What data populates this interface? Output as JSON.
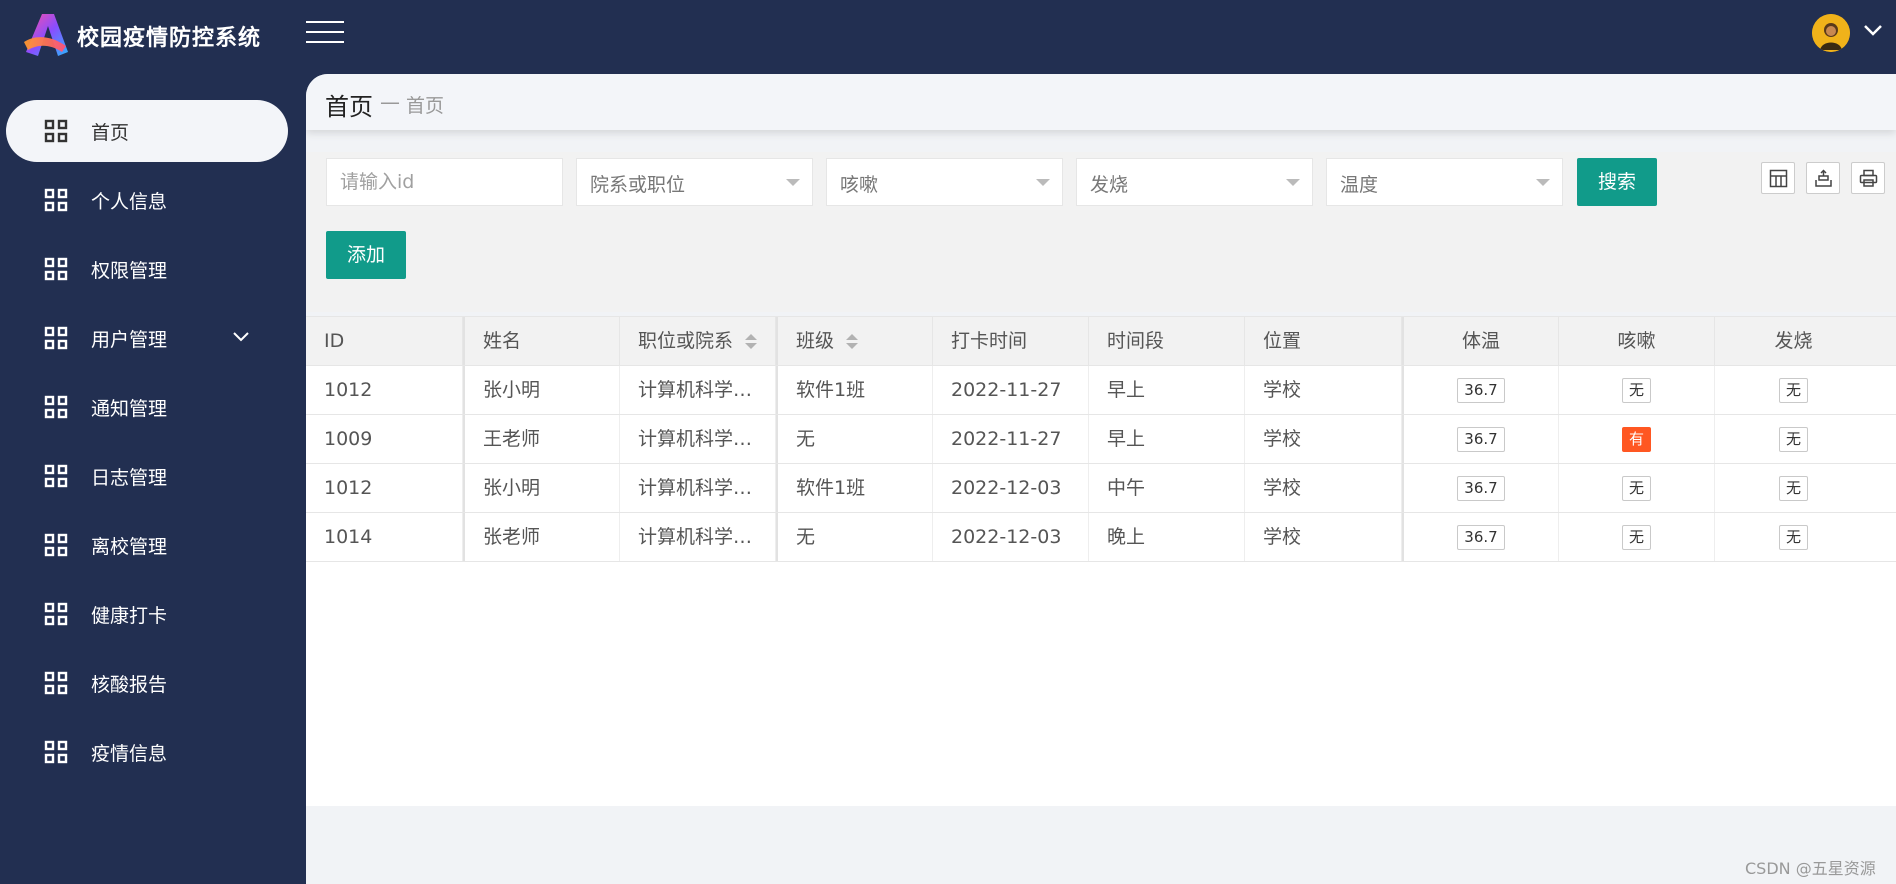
{
  "app": {
    "title": "校园疫情防控系统"
  },
  "breadcrumb": {
    "main": "首页",
    "separator": "—",
    "sub": "首页"
  },
  "sidebar": {
    "items": [
      {
        "label": "首页",
        "active": true
      },
      {
        "label": "个人信息"
      },
      {
        "label": "权限管理"
      },
      {
        "label": "用户管理",
        "has_submenu": true
      },
      {
        "label": "通知管理"
      },
      {
        "label": "日志管理"
      },
      {
        "label": "离校管理"
      },
      {
        "label": "健康打卡"
      },
      {
        "label": "核酸报告"
      },
      {
        "label": "疫情信息"
      }
    ]
  },
  "filters": {
    "id_placeholder": "请输入id",
    "dept_select": "院系或职位",
    "cough_select": "咳嗽",
    "fever_select": "发烧",
    "temp_select": "温度",
    "search_label": "搜索",
    "add_label": "添加"
  },
  "table": {
    "columns": [
      "ID",
      "姓名",
      "职位或院系",
      "班级",
      "打卡时间",
      "时间段",
      "位置",
      "体温",
      "咳嗽",
      "发烧"
    ],
    "rows": [
      {
        "id": "1012",
        "name": "张小明",
        "dept": "计算机科学…",
        "class": "软件1班",
        "time": "2022-11-27",
        "period": "早上",
        "location": "学校",
        "temp": "36.7",
        "cough": "无",
        "fever": "无"
      },
      {
        "id": "1009",
        "name": "王老师",
        "dept": "计算机科学…",
        "class": "无",
        "time": "2022-11-27",
        "period": "早上",
        "location": "学校",
        "temp": "36.7",
        "cough": "有",
        "fever": "无"
      },
      {
        "id": "1012",
        "name": "张小明",
        "dept": "计算机科学…",
        "class": "软件1班",
        "time": "2022-12-03",
        "period": "中午",
        "location": "学校",
        "temp": "36.7",
        "cough": "无",
        "fever": "无"
      },
      {
        "id": "1014",
        "name": "张老师",
        "dept": "计算机科学…",
        "class": "无",
        "time": "2022-12-03",
        "period": "晚上",
        "location": "学校",
        "temp": "36.7",
        "cough": "无",
        "fever": "无"
      }
    ]
  },
  "watermark": "CSDN @五星资源",
  "colors": {
    "sidebar_bg": "#222f51",
    "primary": "#119b8a",
    "danger": "#ff5722"
  }
}
